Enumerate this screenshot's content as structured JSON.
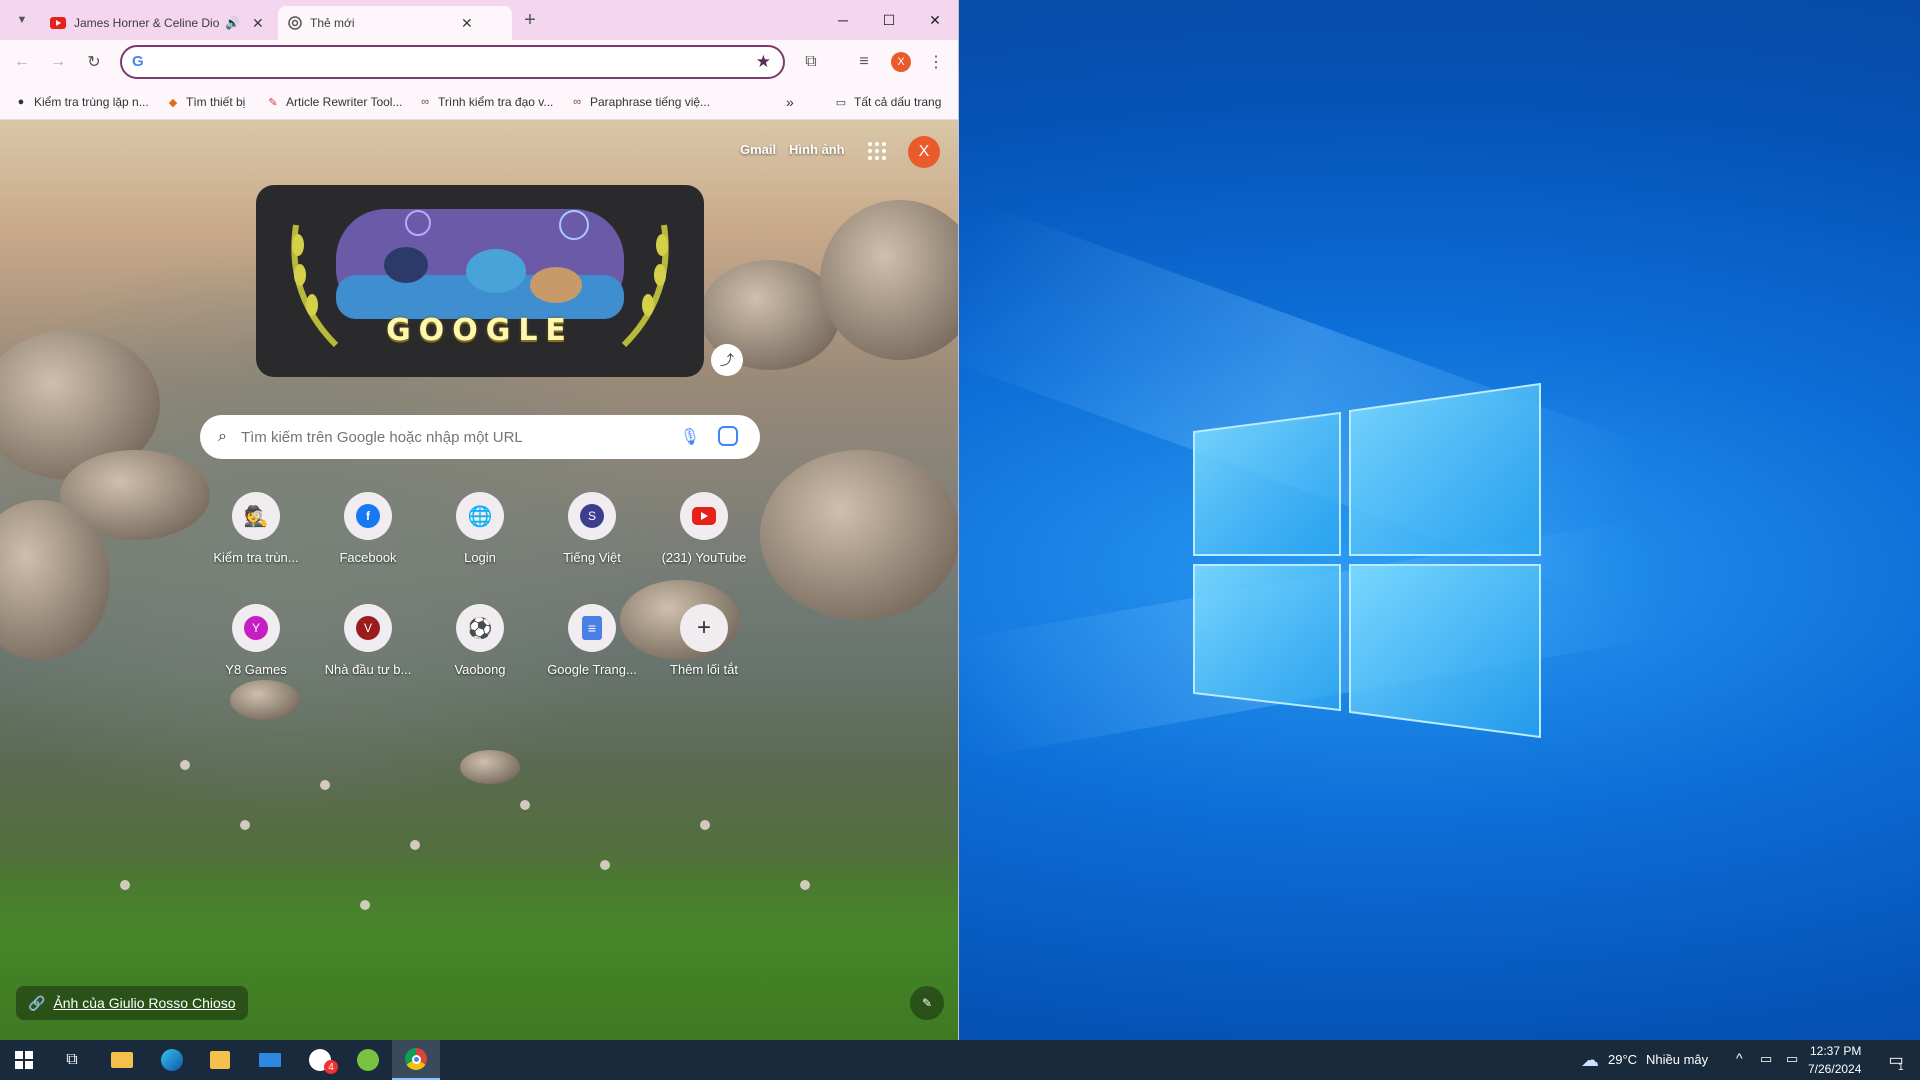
{
  "tabs": [
    {
      "title": "James Horner & Celine Dion",
      "active": false,
      "audio": true
    },
    {
      "title": "Thẻ mới",
      "active": true
    }
  ],
  "omnibox": {
    "value": "",
    "placeholder": ""
  },
  "profile_initial": "X",
  "bookmarks": [
    {
      "label": "Kiểm tra trùng lặp n...",
      "icon": "spy-icon"
    },
    {
      "label": "Tìm thiết bị",
      "icon": "diamond-icon"
    },
    {
      "label": "Article Rewriter Tool...",
      "icon": "pen-icon"
    },
    {
      "label": "Trình kiểm tra đạo v...",
      "icon": "glasses-icon"
    },
    {
      "label": "Paraphrase tiếng việ...",
      "icon": "glasses-icon"
    }
  ],
  "bookmarks_all": "Tất cả dấu trang",
  "ntp": {
    "gmail": "Gmail",
    "images": "Hình ảnh",
    "doodle_text": "GOOGLE",
    "search_placeholder": "Tìm kiếm trên Google hoặc nhập một URL",
    "shortcuts_row1": [
      {
        "label": "Kiểm tra trùn...",
        "icon": "spy-icon"
      },
      {
        "label": "Facebook",
        "icon": "facebook-icon",
        "letter": "f",
        "color": "#1877f2"
      },
      {
        "label": "Login",
        "icon": "globe-icon"
      },
      {
        "label": "Tiếng Việt",
        "icon": "s-icon",
        "letter": "S",
        "color": "#3d3d8f"
      },
      {
        "label": "(231) YouTube",
        "icon": "youtube-icon"
      }
    ],
    "shortcuts_row2": [
      {
        "label": "Y8 Games",
        "icon": "y8-icon",
        "letter": "Y",
        "color": "#c51fc4"
      },
      {
        "label": "Nhà đầu tư b...",
        "icon": "v-icon",
        "letter": "V",
        "color": "#9b1c1c"
      },
      {
        "label": "Vaobong",
        "icon": "soccer-ball-icon"
      },
      {
        "label": "Google Trang...",
        "icon": "docs-icon"
      },
      {
        "label": "Thêm lối tắt",
        "icon": "plus-icon"
      }
    ],
    "credit": "Ảnh của Giulio Rosso Chioso"
  },
  "taskbar": {
    "weather_temp": "29°C",
    "weather_text": "Nhiều mây",
    "time": "12:37 PM",
    "date": "7/26/2024",
    "mail_badge": "4",
    "notif_count": "1"
  },
  "colors": {
    "tabstrip": "#f4d7ee",
    "accent": "#7c3a6e",
    "profile": "#ea5b2b",
    "desktop": "#0d6fd8"
  }
}
